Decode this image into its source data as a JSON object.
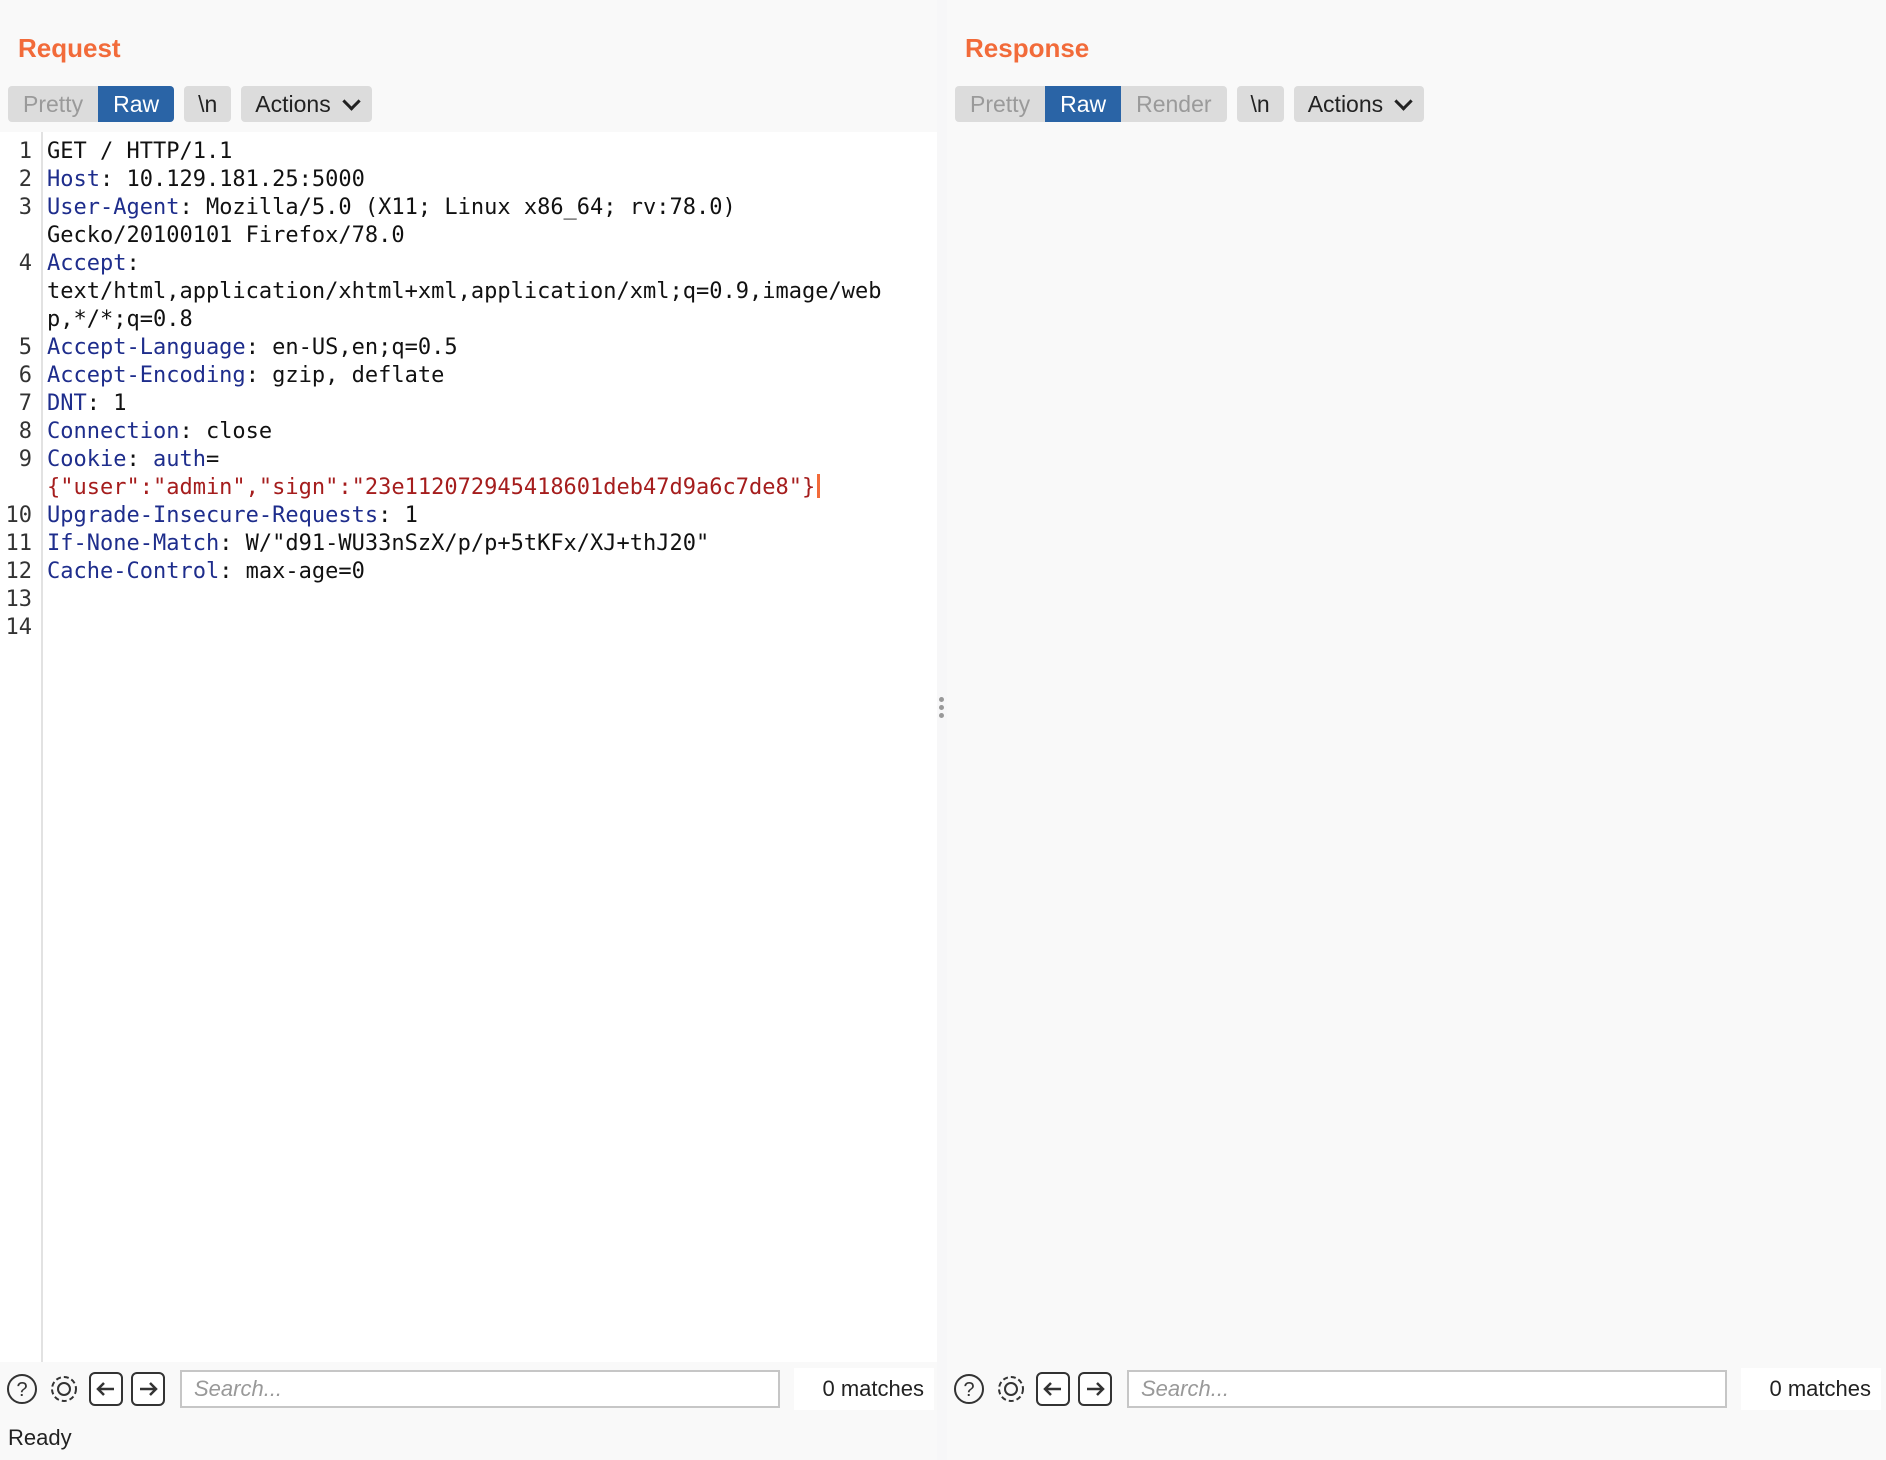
{
  "layout_switch": {
    "options": [
      "side-by-side-icon",
      "stacked-rows-icon",
      "single-pane-icon"
    ],
    "active_index": 0
  },
  "request": {
    "title": "Request",
    "tabs": [
      "Pretty",
      "Raw"
    ],
    "active_tab": "Raw",
    "newline_label": "\\n",
    "actions_label": "Actions",
    "lines": [
      {
        "n": "1",
        "key": "",
        "text": "GET / HTTP/1.1"
      },
      {
        "n": "2",
        "key": "Host",
        "text": ": 10.129.181.25:5000"
      },
      {
        "n": "3",
        "key": "User-Agent",
        "text": ": Mozilla/5.0 (X11; Linux x86_64; rv:78.0)"
      },
      {
        "n": "",
        "key": "",
        "text": "Gecko/20100101 Firefox/78.0"
      },
      {
        "n": "4",
        "key": "Accept",
        "text": ":"
      },
      {
        "n": "",
        "key": "",
        "text": "text/html,application/xhtml+xml,application/xml;q=0.9,image/web"
      },
      {
        "n": "",
        "key": "",
        "text": "p,*/*;q=0.8"
      },
      {
        "n": "5",
        "key": "Accept-Language",
        "text": ": en-US,en;q=0.5"
      },
      {
        "n": "6",
        "key": "Accept-Encoding",
        "text": ": gzip, deflate"
      },
      {
        "n": "7",
        "key": "DNT",
        "text": ": 1"
      },
      {
        "n": "8",
        "key": "Connection",
        "text": ": close"
      },
      {
        "n": "9",
        "key": "Cookie",
        "text": ": auth="
      },
      {
        "n": "",
        "key": "",
        "text": "{\"user\":\"admin\",\"sign\":\"23e112072945418601deb47d9a6c7de8\"}"
      },
      {
        "n": "10",
        "key": "Upgrade-Insecure-Requests",
        "text": ": 1"
      },
      {
        "n": "11",
        "key": "If-None-Match",
        "text": ": W/\"d91-WU33nSzX/p/p+5tKFx/XJ+thJ20\""
      },
      {
        "n": "12",
        "key": "Cache-Control",
        "text": ": max-age=0"
      },
      {
        "n": "13",
        "key": "",
        "text": ""
      },
      {
        "n": "14",
        "key": "",
        "text": ""
      }
    ],
    "cookie_key_word": "auth",
    "search_placeholder": "Search...",
    "matches": "0 matches"
  },
  "response": {
    "title": "Response",
    "tabs": [
      "Pretty",
      "Raw",
      "Render"
    ],
    "active_tab": "Raw",
    "newline_label": "\\n",
    "actions_label": "Actions",
    "search_placeholder": "Search...",
    "matches": "0 matches"
  },
  "status": "Ready",
  "colors": {
    "accent_orange": "#f26b3a",
    "active_tab_blue": "#2a64a6",
    "header_key": "#1e2d8c",
    "cookie_value": "#a51d1d"
  }
}
